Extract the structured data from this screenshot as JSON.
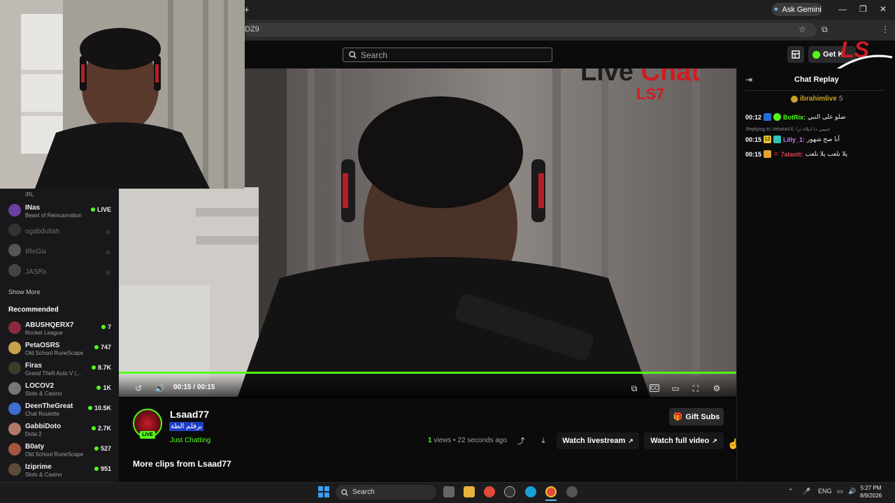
{
  "browser": {
    "url_fragment": "DZ9",
    "ask_gemini": "Ask Gemini",
    "new_tab": "+",
    "window": {
      "minimize": "—",
      "restore": "❐",
      "close": "✕"
    }
  },
  "site": {
    "search_placeholder": "Search",
    "get_button": "Get K",
    "brand_color": "#53fc18"
  },
  "overlay": {
    "stream_overlay_title_1": "Live",
    "stream_overlay_title_2": "Chat",
    "stream_overlay_sub": "LS7",
    "logo_text": "LS"
  },
  "sidebar": {
    "top_partial": {
      "game": "IRL"
    },
    "following": [
      {
        "name": "INas",
        "game": "Beast of Reincarnation",
        "status": "LIVE",
        "color": "#6b3fa0"
      },
      {
        "name": "ogabdullah",
        "status": "offline"
      },
      {
        "name": "IReGix",
        "status": "offline"
      },
      {
        "name": "JASRx",
        "status": "offline"
      }
    ],
    "show_more": "Show More",
    "recommended_title": "Recommended",
    "recommended": [
      {
        "name": "ABUSHQERX7",
        "game": "Rocket League",
        "viewers": "7",
        "color": "#8b2a3c"
      },
      {
        "name": "PetaOSRS",
        "game": "Old School RuneScape",
        "viewers": "747",
        "color": "#c8a24a"
      },
      {
        "name": "Firas",
        "game": "Grand Theft Auto V (...",
        "viewers": "8.7K",
        "color": "#3c3c2a"
      },
      {
        "name": "LOCOV2",
        "game": "Slots & Casino",
        "viewers": "1K",
        "color": "#777"
      },
      {
        "name": "DeenTheGreat",
        "game": "Chat Roulette",
        "viewers": "10.5K",
        "color": "#3d6ed0"
      },
      {
        "name": "GabbiDoto",
        "game": "Dota 2",
        "viewers": "2.7K",
        "color": "#b07a66"
      },
      {
        "name": "B0aty",
        "game": "Old School RuneScape",
        "viewers": "527",
        "color": "#a4573e"
      },
      {
        "name": "Iziprime",
        "game": "Slots & Casino",
        "viewers": "951",
        "color": "#5a4b3a"
      }
    ]
  },
  "player": {
    "time": "00:15 / 00:15",
    "progress": 1.0
  },
  "channel": {
    "name": "Lsaad77",
    "title": "برفلم الطة",
    "category": "Just Chatting",
    "live_badge": "LIVE",
    "views_count": "1",
    "views_label": "views",
    "age": "22 seconds ago",
    "gift_subs": "Gift Subs",
    "watch_livestream": "Watch livestream",
    "watch_full_video": "Watch full video",
    "more_clips": "More clips from Lsaad77"
  },
  "chat": {
    "title": "Chat Replay",
    "pinned_user": "ibrahimlive",
    "pinned_count": "5",
    "reply_text": "Replying to VeloriaVX: حبيبي دا ابتلاء ترا",
    "messages": [
      {
        "time": "00:12",
        "user": "BotRix:",
        "text": "صلو على النبي",
        "user_color": "#53fc18"
      },
      {
        "time": "00:15",
        "user": "Lilly_1:",
        "text": "أنا صح شهور",
        "user_color": "#c27cf5"
      },
      {
        "time": "00:15",
        "user": "7alaott:",
        "text": "يلا نلعب يلا نلعب",
        "user_color": "#e0444f"
      }
    ]
  },
  "taskbar": {
    "search": "Search",
    "lang": "ENG",
    "time": "5:27 PM",
    "date": "8/9/2026"
  }
}
